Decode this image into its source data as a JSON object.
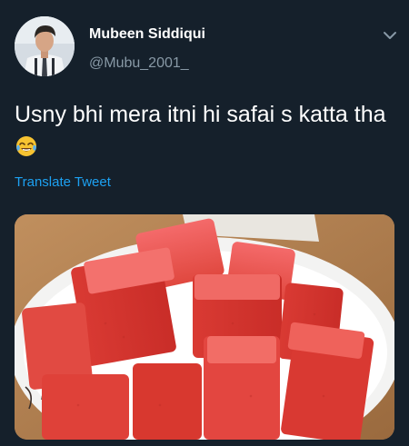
{
  "tweet": {
    "author_name": "Mubeen Siddiqui",
    "author_handle": "@Mubu_2001_",
    "text": "Usny bhi mera itni hi safai s katta tha",
    "emoji": "face-with-tears-of-joy",
    "translate_label": "Translate Tweet",
    "media_alt": "watermelon-cubes-photo"
  },
  "colors": {
    "background": "#15202b",
    "text": "#ffffff",
    "secondary": "#8899a6",
    "link": "#1da1f2"
  },
  "icons": {
    "menu": "chevron-down-icon",
    "avatar": "avatar"
  }
}
